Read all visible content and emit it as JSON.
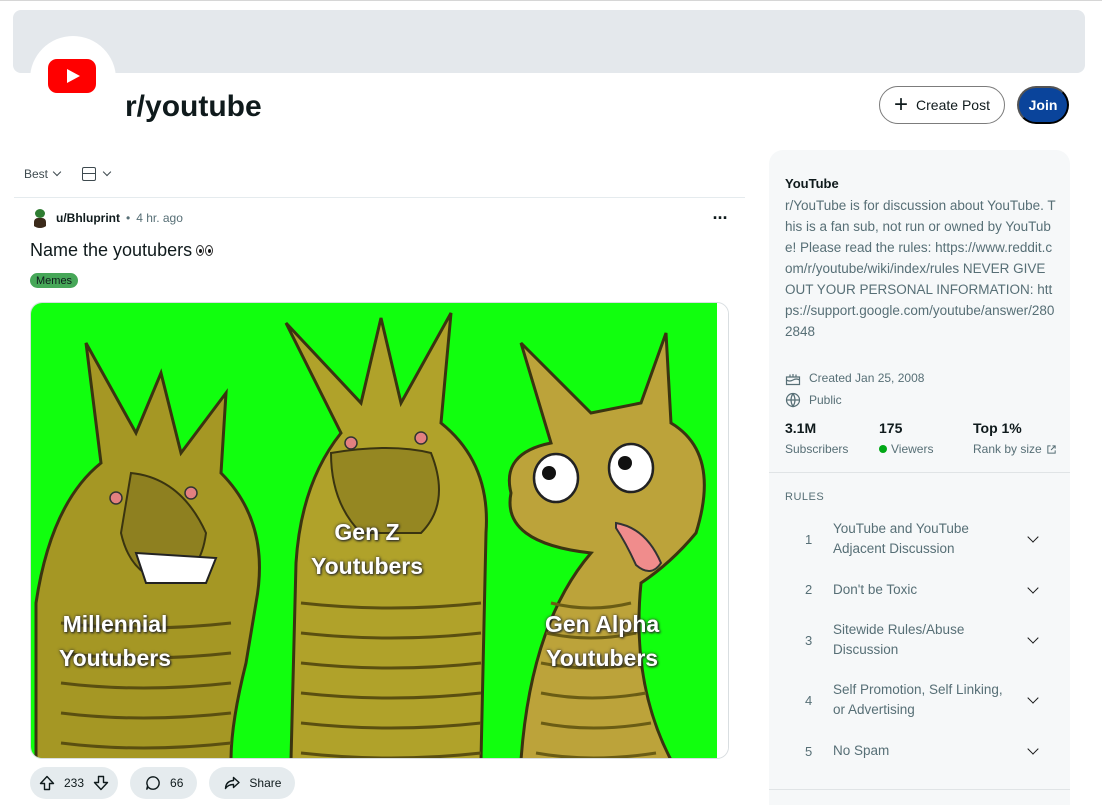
{
  "header": {
    "subreddit_name": "r/youtube",
    "create_post_label": "Create Post",
    "join_label": "Join",
    "avatar_icon": "youtube-logo-icon"
  },
  "feed_controls": {
    "sort_label": "Best"
  },
  "post": {
    "author": "u/Bhluprint",
    "separator": "•",
    "time_ago": "4 hr. ago",
    "title": "Name the youtubers",
    "flair": "Memes",
    "flair_color": "#46a758",
    "image_labels": {
      "left": [
        "Millennial",
        "Youtubers"
      ],
      "middle": [
        "Gen Z",
        "Youtubers"
      ],
      "right": [
        "Gen Alpha",
        "Youtubers"
      ]
    },
    "image_background": "#11ff0e",
    "vote_count": "233",
    "comment_count": "66",
    "share_label": "Share"
  },
  "sidebar": {
    "title": "YouTube",
    "description": "r/YouTube is for discussion about YouTube. This is a fan sub, not run or owned by YouTube! Please read the rules: https://www.reddit.com/r/youtube/wiki/index/rules NEVER GIVE OUT YOUR PERSONAL INFORMATION: https://support.google.com/youtube/answer/2802848",
    "created": "Created Jan 25, 2008",
    "visibility": "Public",
    "stats": [
      {
        "value": "3.1M",
        "label": "Subscribers"
      },
      {
        "value": "175",
        "label": "Viewers"
      },
      {
        "value": "Top 1%",
        "label": "Rank by size"
      }
    ],
    "rules_heading": "RULES",
    "rules": [
      {
        "num": "1",
        "text": "YouTube and YouTube Adjacent Discussion"
      },
      {
        "num": "2",
        "text": "Don't be Toxic"
      },
      {
        "num": "3",
        "text": "Sitewide Rules/Abuse Discussion"
      },
      {
        "num": "4",
        "text": "Self Promotion, Self Linking, or Advertising"
      },
      {
        "num": "5",
        "text": "No Spam"
      }
    ]
  }
}
